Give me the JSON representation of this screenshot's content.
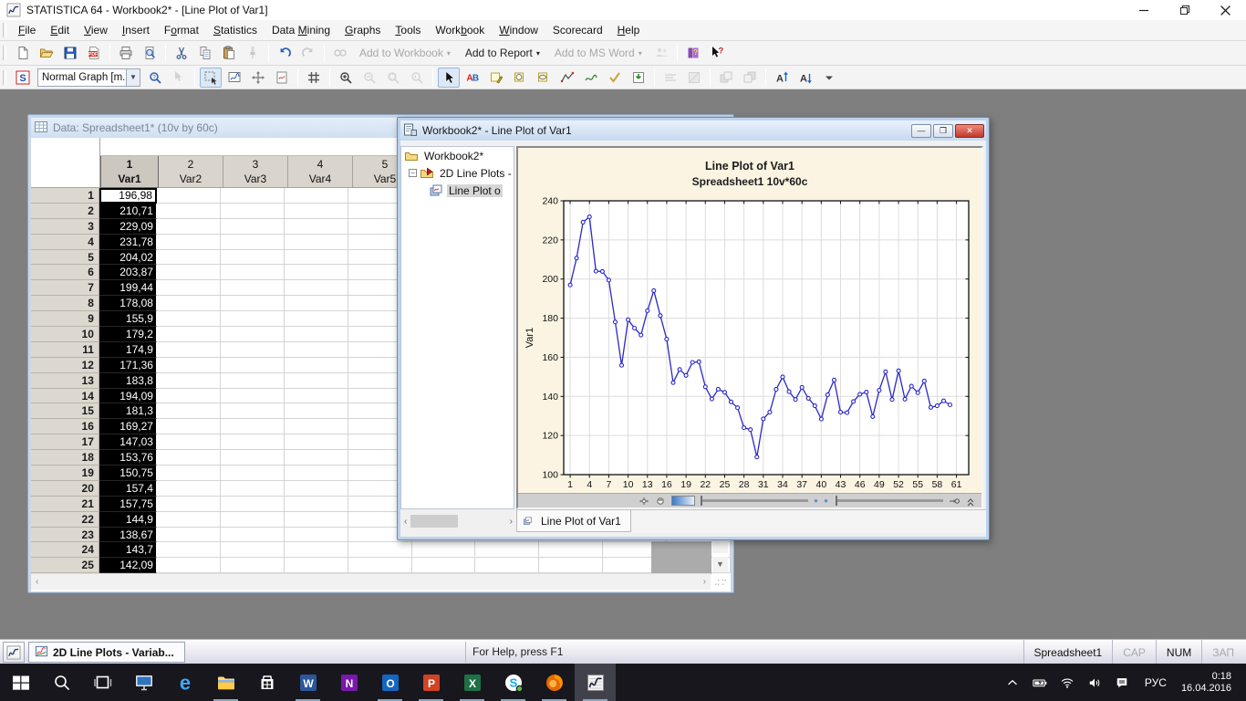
{
  "window": {
    "title": "STATISTICA 64 - Workbook2* - [Line Plot of Var1]"
  },
  "menu": {
    "items": [
      {
        "label": "File",
        "accel": 0
      },
      {
        "label": "Edit",
        "accel": 0
      },
      {
        "label": "View",
        "accel": 0
      },
      {
        "label": "Insert",
        "accel": 0
      },
      {
        "label": "Format",
        "accel": 1
      },
      {
        "label": "Statistics",
        "accel": 0
      },
      {
        "label": "Data Mining",
        "accel": 5
      },
      {
        "label": "Graphs",
        "accel": 0
      },
      {
        "label": "Tools",
        "accel": 0
      },
      {
        "label": "Workbook",
        "accel": 4
      },
      {
        "label": "Window",
        "accel": 0
      },
      {
        "label": "Scorecard",
        "accel": -1
      },
      {
        "label": "Help",
        "accel": 0
      }
    ]
  },
  "toolbar_main": {
    "items": [
      {
        "name": "new"
      },
      {
        "name": "open"
      },
      {
        "name": "save"
      },
      {
        "name": "pdf"
      },
      {
        "type": "sep"
      },
      {
        "name": "print"
      },
      {
        "name": "print-preview"
      },
      {
        "type": "sep"
      },
      {
        "name": "cut"
      },
      {
        "name": "copy"
      },
      {
        "name": "paste"
      },
      {
        "name": "format-painter",
        "enabled": false
      },
      {
        "type": "sep"
      },
      {
        "name": "undo"
      },
      {
        "name": "redo",
        "enabled": false
      },
      {
        "type": "sep"
      },
      {
        "name": "find",
        "enabled": false
      },
      {
        "type": "menu-button",
        "name": "add-to-workbook",
        "label": "Add to Workbook",
        "enabled": false
      },
      {
        "type": "menu-button",
        "name": "add-to-report",
        "label": "Add to Report",
        "enabled": true
      },
      {
        "type": "menu-button",
        "name": "add-to-ms-word",
        "label": "Add to MS Word",
        "enabled": false
      },
      {
        "name": "group-add",
        "enabled": false
      },
      {
        "type": "sep"
      },
      {
        "name": "help-book"
      },
      {
        "name": "whats-this"
      }
    ]
  },
  "toolbar_graph": {
    "style_value": "Normal Graph [m...",
    "items": [
      {
        "name": "s-logo"
      },
      {
        "type": "combo",
        "name": "graph-style"
      },
      {
        "name": "zoom-help"
      },
      {
        "name": "pointer-help",
        "enabled": false
      },
      {
        "type": "sep"
      },
      {
        "name": "select-region",
        "pressed": true
      },
      {
        "name": "edit-graph"
      },
      {
        "name": "move-resize"
      },
      {
        "name": "mini-doc"
      },
      {
        "type": "sep"
      },
      {
        "name": "grid"
      },
      {
        "type": "sep"
      },
      {
        "name": "zoom-in"
      },
      {
        "name": "zoom-out",
        "enabled": false
      },
      {
        "name": "zoom-area",
        "enabled": false
      },
      {
        "name": "zoom-reset",
        "enabled": false
      },
      {
        "type": "sep"
      },
      {
        "name": "pointer",
        "pressed": true
      },
      {
        "name": "text-tool"
      },
      {
        "name": "note-tool"
      },
      {
        "name": "oval-tool"
      },
      {
        "name": "ellipse-tool"
      },
      {
        "name": "polyline-tool"
      },
      {
        "name": "freehand-tool"
      },
      {
        "name": "check-tool"
      },
      {
        "name": "embed-tool"
      },
      {
        "type": "sep"
      },
      {
        "name": "align-lines",
        "enabled": false
      },
      {
        "name": "shade",
        "enabled": false
      },
      {
        "type": "sep"
      },
      {
        "name": "bring-front",
        "enabled": false
      },
      {
        "name": "send-back",
        "enabled": false
      },
      {
        "type": "sep"
      },
      {
        "name": "font-up"
      },
      {
        "name": "font-down"
      },
      {
        "name": "more-dropdown"
      }
    ]
  },
  "spreadsheet_window": {
    "title": "Data: Spreadsheet1* (10v by 60c)",
    "columns": [
      {
        "num": "1",
        "name": "Var1",
        "selected": true
      },
      {
        "num": "2",
        "name": "Var2"
      },
      {
        "num": "3",
        "name": "Var3"
      },
      {
        "num": "4",
        "name": "Var4"
      },
      {
        "num": "5",
        "name": "Var5"
      }
    ],
    "rows": [
      {
        "n": "1",
        "v": "196,98"
      },
      {
        "n": "2",
        "v": "210,71"
      },
      {
        "n": "3",
        "v": "229,09"
      },
      {
        "n": "4",
        "v": "231,78"
      },
      {
        "n": "5",
        "v": "204,02"
      },
      {
        "n": "6",
        "v": "203,87"
      },
      {
        "n": "7",
        "v": "199,44"
      },
      {
        "n": "8",
        "v": "178,08"
      },
      {
        "n": "9",
        "v": "155,9"
      },
      {
        "n": "10",
        "v": "179,2"
      },
      {
        "n": "11",
        "v": "174,9"
      },
      {
        "n": "12",
        "v": "171,36"
      },
      {
        "n": "13",
        "v": "183,8"
      },
      {
        "n": "14",
        "v": "194,09"
      },
      {
        "n": "15",
        "v": "181,3"
      },
      {
        "n": "16",
        "v": "169,27"
      },
      {
        "n": "17",
        "v": "147,03"
      },
      {
        "n": "18",
        "v": "153,76"
      },
      {
        "n": "19",
        "v": "150,75"
      },
      {
        "n": "20",
        "v": "157,4"
      },
      {
        "n": "21",
        "v": "157,75"
      },
      {
        "n": "22",
        "v": "144,9"
      },
      {
        "n": "23",
        "v": "138,67"
      },
      {
        "n": "24",
        "v": "143,7"
      },
      {
        "n": "25",
        "v": "142,09"
      }
    ]
  },
  "workbook_window": {
    "title": "Workbook2* - Line Plot of Var1",
    "tree": {
      "root": "Workbook2*",
      "folder": "2D Line Plots -",
      "leaf": "Line Plot o"
    },
    "tab": "Line Plot of Var1",
    "strip_icons": [
      "pan",
      "hand",
      "gradient-zoom",
      "slider",
      "page-dots",
      "slider",
      "key",
      "collapse"
    ]
  },
  "chart_data": {
    "type": "line",
    "title": "Line Plot of Var1",
    "subtitle": "Spreadsheet1 10v*60c",
    "ylabel": "Var1",
    "xlabel": "",
    "ylim": [
      100,
      240
    ],
    "yticks": [
      100,
      120,
      140,
      160,
      180,
      200,
      220,
      240
    ],
    "xticks": [
      1,
      4,
      7,
      10,
      13,
      16,
      19,
      22,
      25,
      28,
      31,
      34,
      37,
      40,
      43,
      46,
      49,
      52,
      55,
      58,
      61
    ],
    "grid": true,
    "legend": "none",
    "line_color": "#2929c8",
    "marker": "open-circle",
    "plot_bg": "#ffffff",
    "bg": "#fbf4e2",
    "x": [
      1,
      2,
      3,
      4,
      5,
      6,
      7,
      8,
      9,
      10,
      11,
      12,
      13,
      14,
      15,
      16,
      17,
      18,
      19,
      20,
      21,
      22,
      23,
      24,
      25,
      26,
      27,
      28,
      29,
      30,
      31,
      32,
      33,
      34,
      35,
      36,
      37,
      38,
      39,
      40,
      41,
      42,
      43,
      44,
      45,
      46,
      47,
      48,
      49,
      50,
      51,
      52,
      53,
      54,
      55,
      56,
      57,
      58,
      59,
      60
    ],
    "values": [
      196.98,
      210.71,
      229.09,
      231.78,
      204.02,
      203.87,
      199.44,
      178.08,
      155.9,
      179.2,
      174.9,
      171.36,
      183.8,
      194.09,
      181.3,
      169.27,
      147.03,
      153.76,
      150.75,
      157.4,
      157.75,
      144.9,
      138.67,
      143.7,
      142.09,
      137.2,
      134.2,
      124.0,
      123.0,
      109.0,
      128.5,
      131.9,
      143.6,
      150.0,
      142.4,
      138.4,
      144.6,
      139.0,
      135.2,
      128.4,
      140.9,
      148.4,
      131.9,
      131.7,
      137.4,
      141.1,
      142.2,
      129.7,
      143.1,
      152.6,
      138.4,
      153.1,
      138.6,
      145.2,
      141.9,
      147.9,
      134.4,
      135.2,
      137.7,
      135.7
    ]
  },
  "statusbar": {
    "task_button": "2D Line Plots - Variab...",
    "help": "For Help, press F1",
    "doc": "Spreadsheet1",
    "cap": "CAP",
    "num": "NUM",
    "zap": "ЗАП"
  },
  "taskbar": {
    "items": [
      {
        "name": "start"
      },
      {
        "name": "search"
      },
      {
        "name": "task-view"
      },
      {
        "name": "remote-app"
      },
      {
        "name": "edge"
      },
      {
        "name": "explorer",
        "running": true
      },
      {
        "name": "store"
      },
      {
        "name": "word",
        "running": true
      },
      {
        "name": "onenote"
      },
      {
        "name": "outlook",
        "running": true
      },
      {
        "name": "powerpoint",
        "running": true
      },
      {
        "name": "excel",
        "running": true
      },
      {
        "name": "skype",
        "running": true
      },
      {
        "name": "firefox",
        "running": true
      },
      {
        "name": "statistica",
        "running": true,
        "active": true
      }
    ],
    "tray_icons": [
      "chevron-up",
      "battery",
      "wifi",
      "volume",
      "action-center"
    ],
    "lang": "РУС",
    "time": "0:18",
    "date": "16.04.2016"
  }
}
